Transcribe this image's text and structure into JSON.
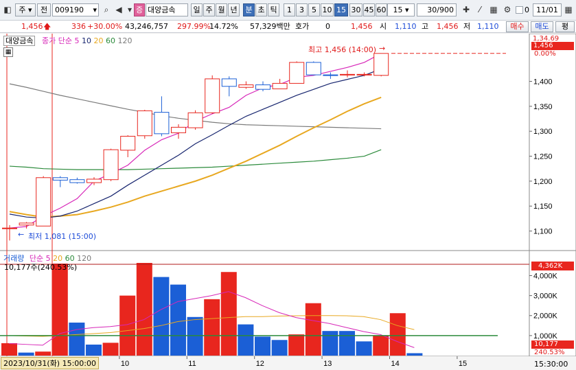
{
  "toolbar": {
    "market_prefix": "주",
    "code_prefix": "전",
    "stock_code": "009190",
    "mode_badge": "증",
    "stock_name": "대양금속",
    "period_buttons": [
      "일",
      "주",
      "월",
      "년",
      "분",
      "초",
      "틱"
    ],
    "selected_period": "분",
    "interval_buttons": [
      "1",
      "3",
      "5",
      "10",
      "15",
      "30",
      "45",
      "60"
    ],
    "selected_interval": "15",
    "interval_value": "15",
    "count": "30/900",
    "checkbox_value": "0",
    "date_value": "11/01"
  },
  "infobar": {
    "price": "1,456",
    "change": "336",
    "change_rate": "+30.00%",
    "volume": "43,246,757",
    "volume_rate": "297.99%",
    "turnover": "14.72%",
    "amount": "57,329백만",
    "quote_label": "호가",
    "quote_value": "0",
    "quote_price": "1,456",
    "open_label": "시",
    "open_value": "1,110",
    "high_label": "고",
    "high_value": "1,456",
    "low_label": "저",
    "low_value": "1,110",
    "buy_button": "매수",
    "sell_button": "매도",
    "eval_button": "평"
  },
  "price_panel": {
    "legend_name": "대양금속",
    "legend_ma_label": "종가 단순",
    "legend_ma": [
      "5",
      "10",
      "20",
      "60",
      "120"
    ],
    "max_annotation": "최고 1,456 (14:00)",
    "min_annotation": "최저 1,081 (15:00)",
    "current_price_tag": "1,456",
    "top_price_tag": "1,34.69",
    "zero_label": "0.00%"
  },
  "volume_panel": {
    "legend_name": "거래량",
    "legend_ma_label": "단순",
    "legend_ma": [
      "5",
      "20",
      "60",
      "120"
    ],
    "volume_info": "10,177주(240.53%)",
    "max_tag": "4,362K",
    "current_tag": "10,177",
    "ratio_tag": "240.53%"
  },
  "x_axis": {
    "cursor_time": "2023/10/31(화) 15:00:00",
    "right_time": "15:30:00",
    "day_labels": [
      "10",
      "11",
      "12",
      "13",
      "14",
      "15"
    ]
  },
  "chart_data": [
    {
      "type": "candlestick",
      "y_ticks": [
        "1,400",
        "1,350",
        "1,300",
        "1,250",
        "1,200",
        "1,150",
        "1,100"
      ],
      "ylim": [
        1065,
        1475
      ],
      "candles": [
        {
          "o": 1105,
          "h": 1112,
          "l": 1081,
          "c": 1106
        },
        {
          "o": 1112,
          "h": 1118,
          "l": 1105,
          "c": 1116
        },
        {
          "o": 1110,
          "h": 1210,
          "l": 1110,
          "c": 1207
        },
        {
          "o": 1207,
          "h": 1210,
          "l": 1188,
          "c": 1202
        },
        {
          "o": 1203,
          "h": 1207,
          "l": 1195,
          "c": 1197
        },
        {
          "o": 1197,
          "h": 1208,
          "l": 1192,
          "c": 1204
        },
        {
          "o": 1203,
          "h": 1265,
          "l": 1200,
          "c": 1263
        },
        {
          "o": 1262,
          "h": 1292,
          "l": 1248,
          "c": 1290
        },
        {
          "o": 1291,
          "h": 1343,
          "l": 1285,
          "c": 1341
        },
        {
          "o": 1338,
          "h": 1370,
          "l": 1290,
          "c": 1295
        },
        {
          "o": 1297,
          "h": 1314,
          "l": 1285,
          "c": 1308
        },
        {
          "o": 1307,
          "h": 1342,
          "l": 1303,
          "c": 1337
        },
        {
          "o": 1337,
          "h": 1412,
          "l": 1335,
          "c": 1405
        },
        {
          "o": 1405,
          "h": 1410,
          "l": 1370,
          "c": 1390
        },
        {
          "o": 1388,
          "h": 1400,
          "l": 1385,
          "c": 1393
        },
        {
          "o": 1393,
          "h": 1400,
          "l": 1380,
          "c": 1384
        },
        {
          "o": 1385,
          "h": 1405,
          "l": 1385,
          "c": 1396
        },
        {
          "o": 1396,
          "h": 1440,
          "l": 1396,
          "c": 1438
        },
        {
          "o": 1438,
          "h": 1440,
          "l": 1412,
          "c": 1413
        },
        {
          "o": 1413,
          "h": 1418,
          "l": 1405,
          "c": 1412
        },
        {
          "o": 1413,
          "h": 1422,
          "l": 1408,
          "c": 1414
        },
        {
          "o": 1413,
          "h": 1418,
          "l": 1410,
          "c": 1414
        },
        {
          "o": 1412,
          "h": 1456,
          "l": 1410,
          "c": 1456
        }
      ],
      "ma5": [
        1106,
        1109,
        1130,
        1146,
        1165,
        1200,
        1215,
        1232,
        1262,
        1283,
        1296,
        1320,
        1335,
        1348,
        1372,
        1387,
        1394,
        1408,
        1412,
        1420,
        1428,
        1438,
        1456
      ],
      "ma10": [
        1134,
        1128,
        1126,
        1130,
        1140,
        1155,
        1170,
        1192,
        1212,
        1232,
        1252,
        1275,
        1293,
        1312,
        1330,
        1344,
        1358,
        1372,
        1384,
        1396,
        1404,
        1412,
        1425
      ],
      "ma20": [
        1139,
        1133,
        1128,
        1130,
        1133,
        1140,
        1148,
        1158,
        1170,
        1180,
        1190,
        1200,
        1212,
        1226,
        1240,
        1256,
        1272,
        1290,
        1307,
        1323,
        1340,
        1355,
        1368
      ],
      "ma60": [
        1230,
        1228,
        1225,
        1224,
        1223,
        1223,
        1223,
        1223,
        1224,
        1225,
        1226,
        1227,
        1228,
        1230,
        1232,
        1234,
        1236,
        1238,
        1240,
        1243,
        1246,
        1250,
        1263
      ],
      "ma120": [
        1395,
        1388,
        1380,
        1372,
        1365,
        1358,
        1351,
        1344,
        1338,
        1331,
        1326,
        1322,
        1318,
        1315,
        1313,
        1312,
        1311,
        1310,
        1309,
        1308,
        1307,
        1306,
        1305
      ]
    },
    {
      "type": "bar",
      "y_ticks": [
        "4,000K",
        "3,000K",
        "2,000K",
        "1,000K"
      ],
      "ylim": [
        0,
        4600
      ],
      "values": [
        620,
        150,
        200,
        4600,
        1650,
        550,
        640,
        3000,
        4700,
        3930,
        3550,
        1930,
        2820,
        4180,
        1560,
        950,
        780,
        1060,
        2620,
        1230,
        1230,
        710,
        1000,
        2120,
        120
      ],
      "colors": [
        "r",
        "b",
        "r",
        "r",
        "b",
        "b",
        "r",
        "r",
        "r",
        "b",
        "b",
        "b",
        "r",
        "r",
        "b",
        "b",
        "b",
        "r",
        "r",
        "b",
        "b",
        "b",
        "r",
        "r",
        "b"
      ],
      "ma5": [
        600,
        560,
        520,
        1100,
        1300,
        1400,
        1450,
        1550,
        1800,
        2300,
        2700,
        2850,
        3000,
        3200,
        2900,
        2500,
        2150,
        1900,
        1750,
        1600,
        1400,
        1200,
        1050,
        700,
        400
      ],
      "ma20": [
        1000,
        980,
        960,
        1000,
        1050,
        1100,
        1150,
        1250,
        1350,
        1500,
        1700,
        1800,
        1850,
        1900,
        1950,
        1950,
        1980,
        1990,
        2000,
        2000,
        1990,
        1950,
        1800,
        1500,
        1300
      ]
    }
  ],
  "colors": {
    "up": "#e8261e",
    "down": "#1b5fd6",
    "ma5": "#d726b8",
    "ma10": "#16246e",
    "ma20": "#e8a820",
    "ma60": "#2a8a3a",
    "ma120": "#7a7a7a"
  }
}
